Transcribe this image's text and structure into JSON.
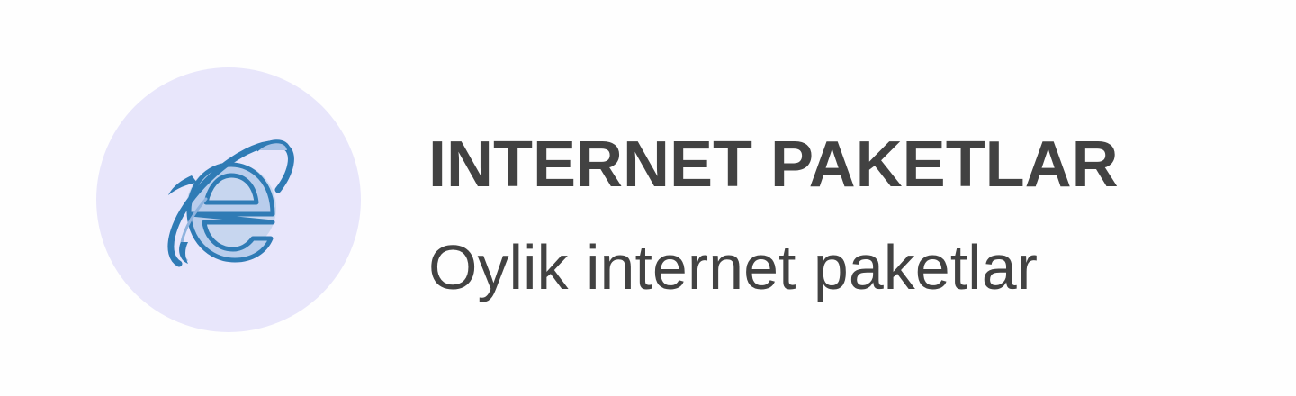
{
  "item": {
    "icon": "internet-explorer-icon",
    "title": "INTERNET PAKETLAR",
    "subtitle": "Oylik internet paketlar",
    "icon_background": "#e8e6fb",
    "icon_color": "#2f7bb5",
    "text_color": "#424242"
  }
}
